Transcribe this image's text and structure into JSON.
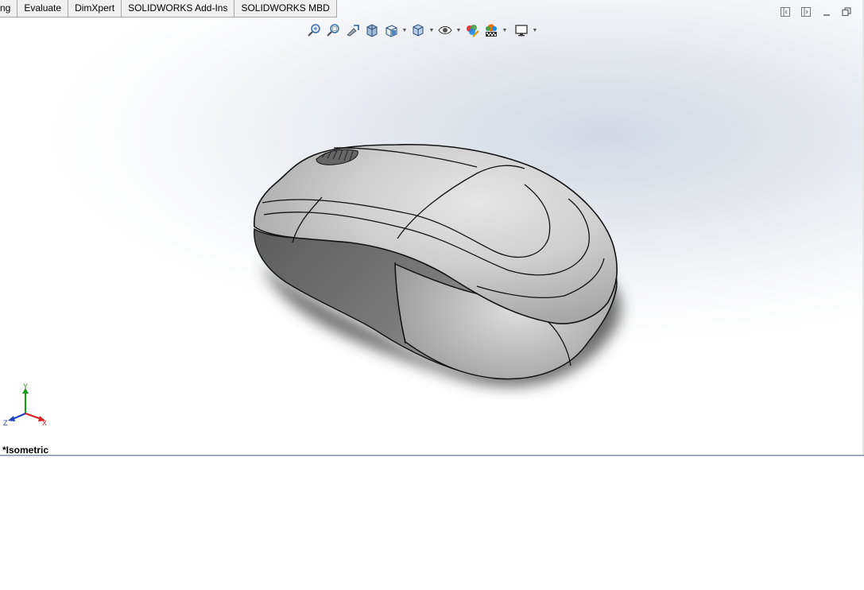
{
  "tabs": [
    {
      "label": "ng"
    },
    {
      "label": "Evaluate"
    },
    {
      "label": "DimXpert"
    },
    {
      "label": "SOLIDWORKS Add-Ins"
    },
    {
      "label": "SOLIDWORKS MBD"
    }
  ],
  "heads_up_toolbar": {
    "icons": [
      "zoom-to-fit-icon",
      "zoom-to-area-icon",
      "previous-view-icon",
      "section-view-icon",
      "view-orientation-icon",
      "display-style-icon",
      "hide-show-items-icon",
      "edit-appearance-icon",
      "apply-scene-icon",
      "view-settings-icon"
    ]
  },
  "window_controls": [
    "tile-left-icon",
    "tile-right-icon",
    "minimize-icon",
    "restore-icon"
  ],
  "triad": {
    "x_label": "X",
    "y_label": "Y",
    "z_label": "Z"
  },
  "view_label": "*Isometric",
  "colors": {
    "axis_x": "#d42020",
    "axis_y": "#1a9a1a",
    "axis_z": "#2040c0",
    "model_surface": "#c8c8c8"
  }
}
